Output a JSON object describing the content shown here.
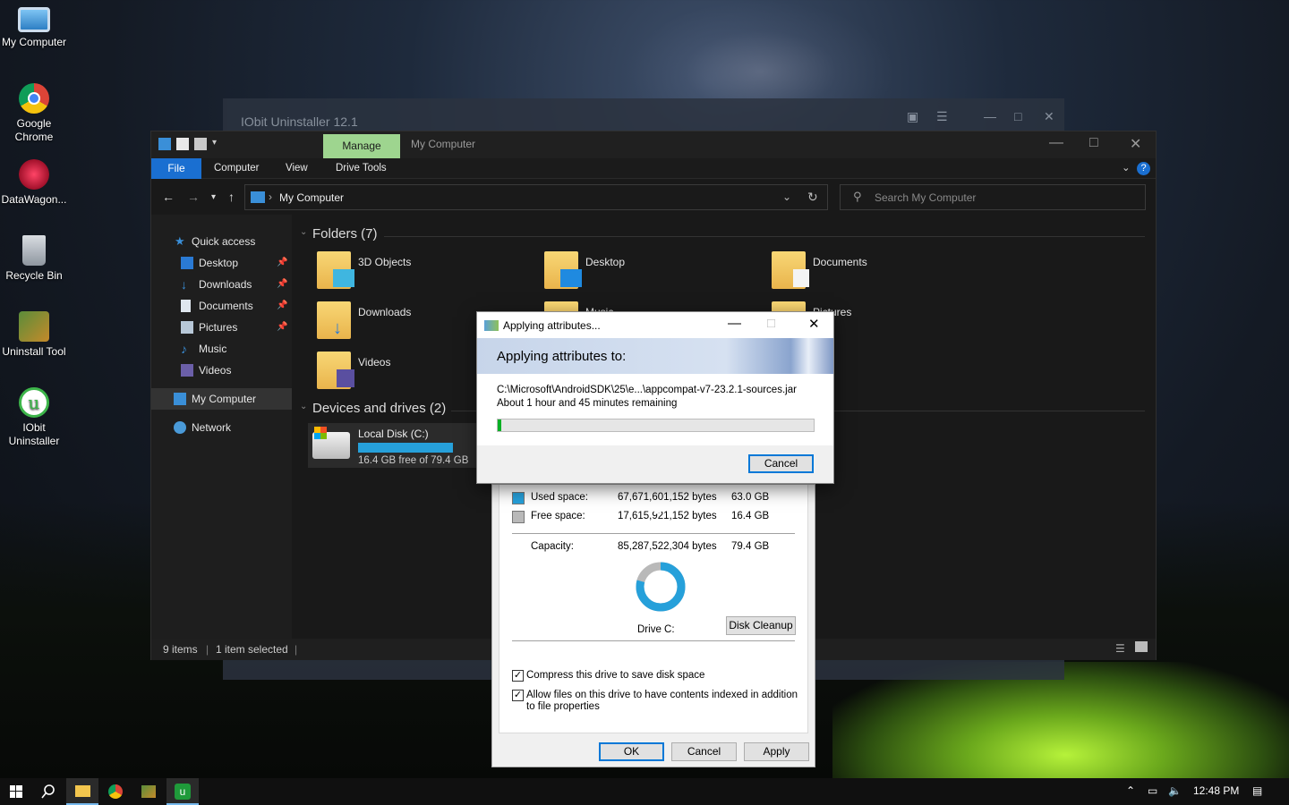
{
  "desktop": {
    "icons": [
      {
        "label": "My Computer",
        "icon": "computer-icon"
      },
      {
        "label": "Google Chrome",
        "icon": "chrome-icon"
      },
      {
        "label": "DataWagon...",
        "icon": "datawagon-icon"
      },
      {
        "label": "Recycle Bin",
        "icon": "recycle-bin-icon"
      },
      {
        "label": "Uninstall Tool",
        "icon": "uninstall-tool-icon"
      },
      {
        "label": "IObit Uninstaller",
        "icon": "iobit-icon"
      }
    ]
  },
  "iobit_window": {
    "title": "IObit Uninstaller 12.1"
  },
  "explorer": {
    "manage_tab": "Manage",
    "title": "My Computer",
    "ribbon": {
      "file": "File",
      "computer": "Computer",
      "view": "View",
      "drive_tools": "Drive Tools"
    },
    "address": "My Computer",
    "search_placeholder": "Search My Computer",
    "nav": {
      "quick_access": "Quick access",
      "desktop": "Desktop",
      "downloads": "Downloads",
      "documents": "Documents",
      "pictures": "Pictures",
      "music": "Music",
      "videos": "Videos",
      "my_computer": "My Computer",
      "network": "Network"
    },
    "folders_header": "Folders (7)",
    "folders": [
      "3D Objects",
      "Desktop",
      "Documents",
      "Downloads",
      "Music",
      "Pictures",
      "Videos"
    ],
    "devices_header": "Devices and drives (2)",
    "drive": {
      "name": "Local Disk (C:)",
      "free": "16.4 GB free of 79.4 GB",
      "used_fraction": 0.793
    },
    "status": {
      "items": "9 items",
      "selected": "1 item selected"
    }
  },
  "properties": {
    "used_label": "Used space:",
    "used_bytes": "67,671,601,152 bytes",
    "used_gb": "63.0 GB",
    "free_label": "Free space:",
    "free_bytes": "17,615,921,152 bytes",
    "free_gb": "16.4 GB",
    "capacity_label": "Capacity:",
    "capacity_bytes": "85,287,522,304 bytes",
    "capacity_gb": "79.4 GB",
    "drive_label": "Drive C:",
    "disk_cleanup": "Disk Cleanup",
    "compress_label": "Compress this drive to save disk space",
    "compress_checked": true,
    "index_label": "Allow files on this drive to have contents indexed in addition to file properties",
    "index_checked": true,
    "ok": "OK",
    "cancel": "Cancel",
    "apply": "Apply",
    "colors": {
      "used": "#26a0da",
      "free": "#b9b9b9"
    }
  },
  "apply_dialog": {
    "title": "Applying attributes...",
    "header": "Applying attributes to:",
    "path": "C:\\Microsoft\\AndroidSDK\\25\\e...\\appcompat-v7-23.2.1-sources.jar",
    "remaining": "About 1 hour and 45 minutes remaining",
    "progress": 0.01,
    "cancel": "Cancel"
  },
  "taskbar": {
    "time": "12:48 PM",
    "items": [
      "start-icon",
      "search-icon",
      "file-explorer-icon",
      "chrome-icon",
      "uninstall-tool-icon",
      "iobit-icon"
    ]
  }
}
